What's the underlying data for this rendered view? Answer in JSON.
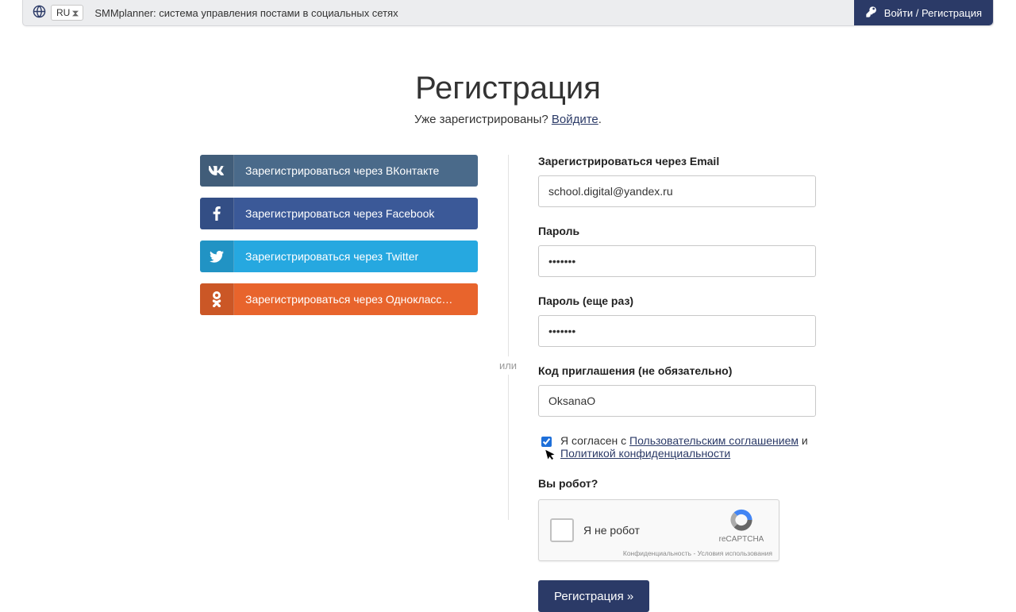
{
  "header": {
    "language": "RU",
    "tagline": "SMMplanner: система управления постами в социальных сетях",
    "login_text": "Войти / Регистрация"
  },
  "page": {
    "title": "Регистрация",
    "already_text": "Уже зарегистрированы? ",
    "already_link": "Войдите",
    "divider": "или"
  },
  "social": {
    "vk_label": "Зарегистрироваться через ВКонтакте",
    "fb_label": "Зарегистрироваться через Facebook",
    "tw_label": "Зарегистрироваться через Twitter",
    "ok_label": "Зарегистрироваться через Однокласс…"
  },
  "form": {
    "email_label": "Зарегистрироваться через Email",
    "email_value": "school.digital@yandex.ru",
    "password_label": "Пароль",
    "password_value": "•••••••",
    "password2_label": "Пароль (еще раз)",
    "password2_value": "•••••••",
    "invite_label": "Код приглашения (не обязательно)",
    "invite_value": "OksanaO",
    "agree_prefix": "Я согласен с ",
    "agree_link1": "Пользовательским соглашением",
    "agree_and": " и ",
    "agree_link2": "Политикой конфиденциальности",
    "robot_label": "Вы робот?",
    "captcha_label": "Я не робот",
    "captcha_brand": "reCAPTCHA",
    "captcha_foot": "Конфиденциальность - Условия использования",
    "submit_label": "Регистрация »"
  }
}
